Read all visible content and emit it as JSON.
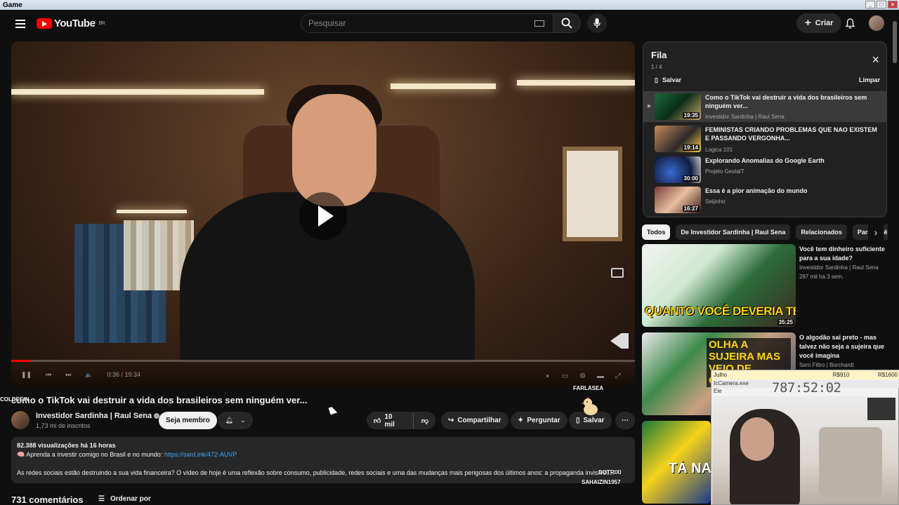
{
  "window": {
    "title": "Game"
  },
  "header": {
    "logo_text": "YouTube",
    "logo_region": "BR",
    "search_placeholder": "Pesquisar",
    "create_label": "Criar"
  },
  "video": {
    "title": "como o TikTok vai destruir a vida dos brasileiros sem ninguém ver...",
    "time": "0:36 / 19:34",
    "progress": 0.03
  },
  "channel": {
    "name": "Investidor Sardinha | Raul Sena",
    "subscribers": "1,73 mi de inscritos",
    "member_label": "Seja membro"
  },
  "actions": {
    "likes": "10 mil",
    "share": "Compartilhar",
    "ask": "Perguntar",
    "save": "Salvar"
  },
  "description": {
    "meta": "82.388 visualizações  há 16 horas",
    "line1": "🧠 Aprenda a investir comigo no Brasil e no mundo: ",
    "link": "https://sard.ink/472-AUVP",
    "para": "As redes sociais estão destruindo a sua vida financeira? O vídeo de hoje é uma reflexão sobre consumo, publicidade, redes sociais e uma das mudanças mais perigosas dos últimos anos: a propaganda invisível..."
  },
  "comments": {
    "count": "731 comentários",
    "sort_label": "Ordenar por"
  },
  "queue": {
    "title": "Fila",
    "count": "1 / 4",
    "save_label": "Salvar",
    "clear_label": "Limpar",
    "items": [
      {
        "title": "Como o TikTok vai destruir a vida dos brasileiros sem ninguém ver...",
        "channel": "Investidor Sardinha | Raul Sena",
        "duration": "19:35"
      },
      {
        "title": "FEMINISTAS CRIANDO PROBLEMAS QUE NAO EXISTEM E PASSANDO VERGONHA...",
        "channel": "Logica 101",
        "duration": "19:14"
      },
      {
        "title": "Explorando Anomalias do Google Earth",
        "channel": "Projeto GestalT",
        "duration": "30:00"
      },
      {
        "title": "Essa é a pior animação do mundo",
        "channel": "Seijinho",
        "duration": "16:27"
      }
    ]
  },
  "chips": [
    "Todos",
    "De Investidor Sardinha | Raul Sena",
    "Relacionados",
    "Para você"
  ],
  "recommendations": [
    {
      "title": "Você tem dinheiro suficiente para a sua idade?",
      "channel": "Investidor Sardinha | Raul Sena",
      "meta": "287 mil  há 3 sem.",
      "duration": "35:25",
      "thumb_text": "QUANTO VOCÊ DEVERIA TER?"
    },
    {
      "title": "O algodão sai preto - mas talvez não seja a sujeira que você imagina",
      "channel": "Sem Filtro | Borchardt",
      "meta": "",
      "duration": "",
      "thumb_text": "OLHA A SUJEIRA MAS VEIO DE ONDE?"
    },
    {
      "title": "",
      "channel": "",
      "meta": "",
      "duration": "",
      "thumb_text": "TÁ NA HORA DE IR E..."
    }
  ],
  "overlay": {
    "user": "Julho",
    "left_balance": "R$910",
    "right_balance": "R$1600",
    "app": "IcCamera.exe",
    "sub": "Eie",
    "timer": "787:52:02"
  },
  "stream_chat": {
    "name1": "COLDEEIN",
    "name2": "FARLASEA",
    "name3": "BOTRIXI",
    "name4": "SAHAIZIN1957"
  },
  "colors": {
    "accent": "#ff0000",
    "link": "#3ea6ff",
    "bg": "#0f0f0f"
  }
}
